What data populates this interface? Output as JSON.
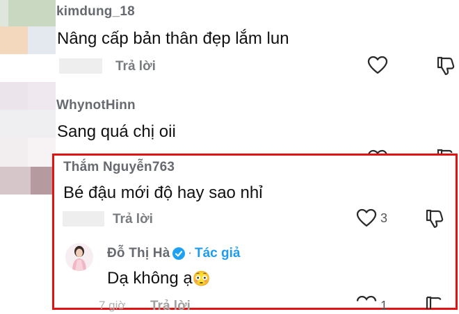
{
  "comments": [
    {
      "username": "kimdung_18",
      "text": "Nâng cấp bản thân đẹp lắm lun",
      "reply_label": "Trả lời"
    },
    {
      "username": "WhynotHinn",
      "text": "Sang quá chị oii"
    },
    {
      "username": "Thắm Nguyễn763",
      "text": "Bé đậu mới độ hay sao nhỉ",
      "reply_label": "Trả lời",
      "like_count": "3",
      "replies": [
        {
          "username": "Đỗ Thị Hà",
          "author_tag": "Tác giả",
          "text": "Dạ không ạ",
          "emoji": "😳",
          "time": "7 giờ",
          "reply_label": "Trả lời",
          "like_count": "1"
        }
      ]
    }
  ],
  "colors": {
    "highlight_border": "#e01212",
    "verified_badge": "#1ea1f2",
    "author_tag": "#1e9df0"
  },
  "icons": [
    "heart-icon",
    "dislike-icon",
    "verified-icon"
  ]
}
